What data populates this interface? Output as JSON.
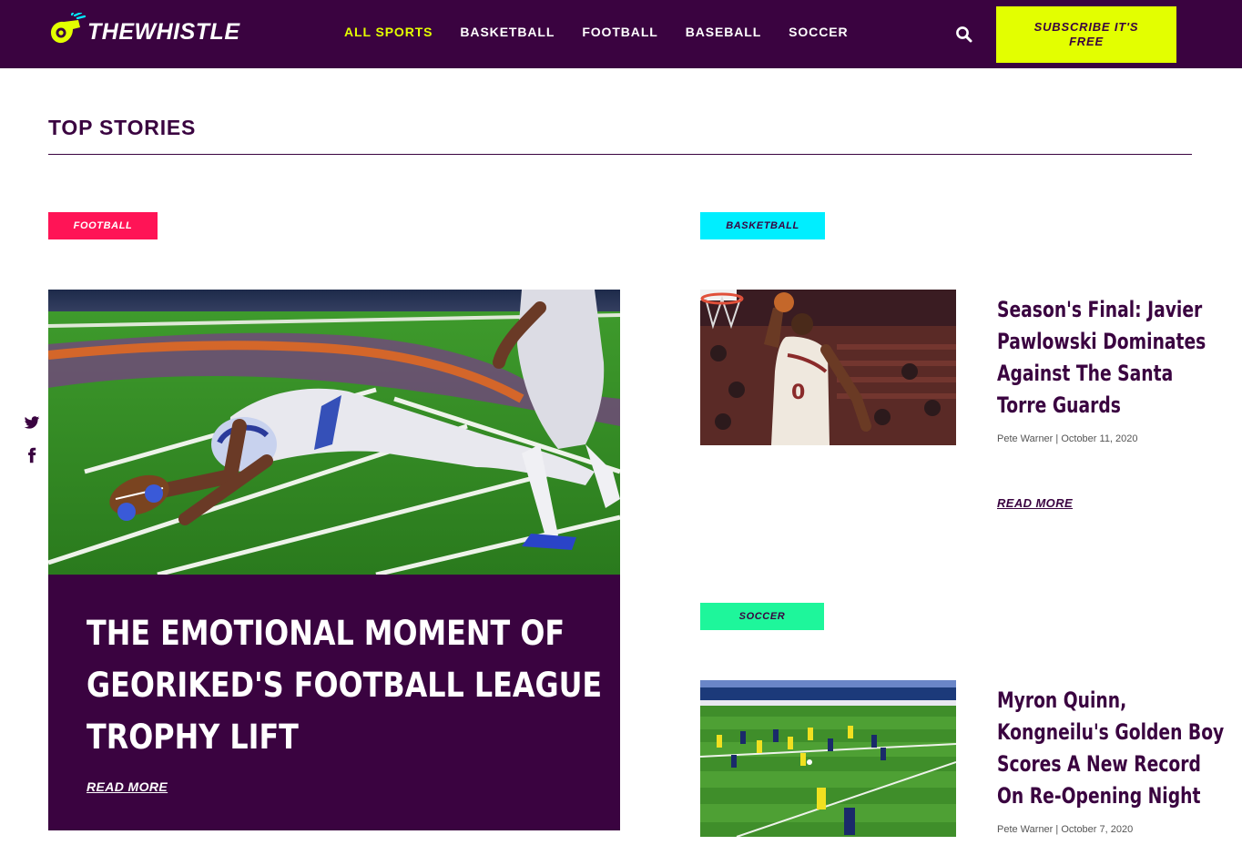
{
  "brand": {
    "name": "THEWHISTLE"
  },
  "nav": {
    "items": [
      {
        "label": "ALL SPORTS",
        "active": true
      },
      {
        "label": "BASKETBALL",
        "active": false
      },
      {
        "label": "FOOTBALL",
        "active": false
      },
      {
        "label": "BASEBALL",
        "active": false
      },
      {
        "label": "SOCCER",
        "active": false
      }
    ],
    "search_icon": "search-icon"
  },
  "subscribe": {
    "label": "SUBSCRIBE IT'S FREE"
  },
  "section": {
    "title": "TOP STORIES"
  },
  "social": {
    "icons": [
      "twitter-icon",
      "facebook-icon"
    ]
  },
  "featured": {
    "tag": "FOOTBALL",
    "title_lines": [
      "THE EMOTIONAL MOMENT OF",
      "GEORIKED'S FOOTBALL LEAGUE",
      "TROPHY LIFT"
    ],
    "read_more": "READ MORE"
  },
  "stories": [
    {
      "tag": "BASKETBALL",
      "title_lines": [
        "Season's Final: Javier",
        "Pawlowski Dominates",
        "Against The Santa",
        "Torre Guards"
      ],
      "author": "Pete Warner",
      "date": "October 11, 2020",
      "read_more": "READ MORE"
    },
    {
      "tag": "SOCCER",
      "title_lines": [
        "Myron Quinn,",
        "Kongneilu's Golden Boy",
        "Scores A New Record",
        "On Re-Opening Night"
      ],
      "author": "Pete Warner",
      "date": "October 7, 2020"
    }
  ],
  "colors": {
    "primary": "#3a0340",
    "accent": "#e3ff00",
    "football_tag": "#ff1456",
    "basketball_tag": "#00eeff",
    "soccer_tag": "#1ef69b"
  }
}
